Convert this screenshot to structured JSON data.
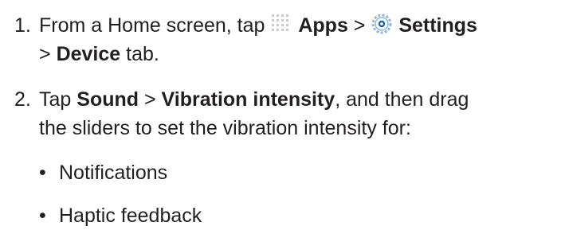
{
  "steps": [
    {
      "number": "1.",
      "line1": {
        "pre": "From a Home screen, tap",
        "apps": "Apps",
        "sep1": ">",
        "settings": "Settings"
      },
      "line2": {
        "sep": ">",
        "device": "Device",
        "post": "tab."
      },
      "icons": [
        "apps-grid-icon",
        "settings-gear-icon"
      ]
    },
    {
      "number": "2.",
      "line1": {
        "pre": "Tap",
        "sound": "Sound",
        "sep": ">",
        "vib": "Vibration intensity",
        "post": ", and then drag"
      },
      "line2": "the sliders to set the vibration intensity for:",
      "bullets": [
        "Notifications",
        "Haptic feedback"
      ]
    }
  ],
  "colors": {
    "text": "#231f20",
    "icon_dots": "#c9cbce",
    "gear_ring": "#8fb7de",
    "gear_center": "#1f66b1"
  }
}
